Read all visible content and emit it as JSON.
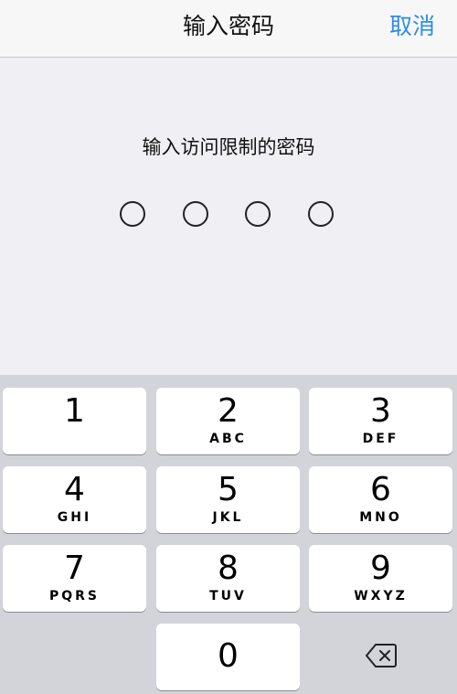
{
  "nav": {
    "title": "输入密码",
    "cancel_label": "取消"
  },
  "prompt": {
    "text": "输入访问限制的密码"
  },
  "passcode": {
    "length": 4,
    "filled": 0
  },
  "keypad": {
    "keys": [
      {
        "digit": "1",
        "letters": ""
      },
      {
        "digit": "2",
        "letters": "ABC"
      },
      {
        "digit": "3",
        "letters": "DEF"
      },
      {
        "digit": "4",
        "letters": "GHI"
      },
      {
        "digit": "5",
        "letters": "JKL"
      },
      {
        "digit": "6",
        "letters": "MNO"
      },
      {
        "digit": "7",
        "letters": "PQRS"
      },
      {
        "digit": "8",
        "letters": "TUV"
      },
      {
        "digit": "9",
        "letters": "WXYZ"
      },
      {
        "digit": "0",
        "letters": ""
      }
    ],
    "delete_icon": "backspace-icon"
  },
  "colors": {
    "accent": "#2e8ce6",
    "background": "#efeff4",
    "keyboard": "#d2d4d9",
    "key": "#ffffff"
  }
}
